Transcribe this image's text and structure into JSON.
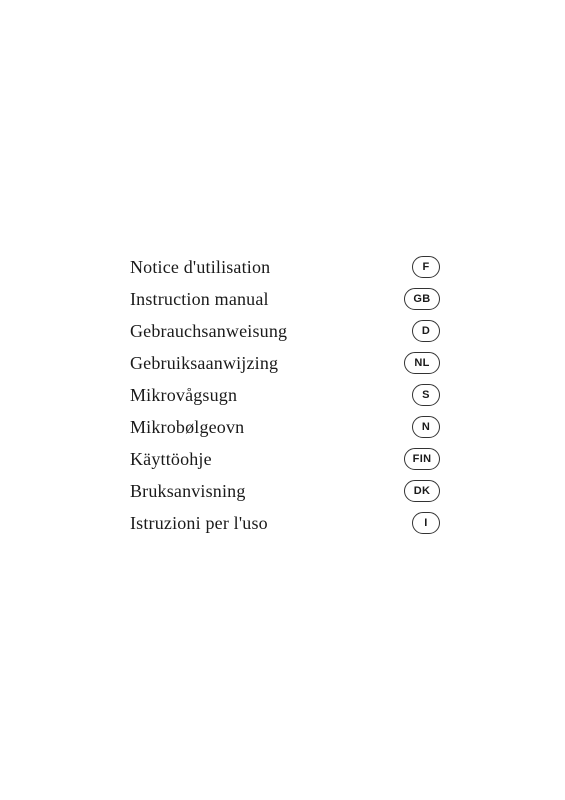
{
  "items": [
    {
      "label": "Notice d'utilisation",
      "badge": "F",
      "wide": false
    },
    {
      "label": "Instruction manual",
      "badge": "GB",
      "wide": true
    },
    {
      "label": "Gebrauchsanweisung",
      "badge": "D",
      "wide": false
    },
    {
      "label": "Gebruiksaanwijzing",
      "badge": "NL",
      "wide": true
    },
    {
      "label": "Mikrovågsugn",
      "badge": "S",
      "wide": false
    },
    {
      "label": "Mikrobølgeovn",
      "badge": "N",
      "wide": false
    },
    {
      "label": "Käyttöohje",
      "badge": "FIN",
      "wide": true
    },
    {
      "label": "Bruksanvisning",
      "badge": "DK",
      "wide": true
    },
    {
      "label": "Istruzioni per l'uso",
      "badge": "I",
      "wide": false
    }
  ]
}
